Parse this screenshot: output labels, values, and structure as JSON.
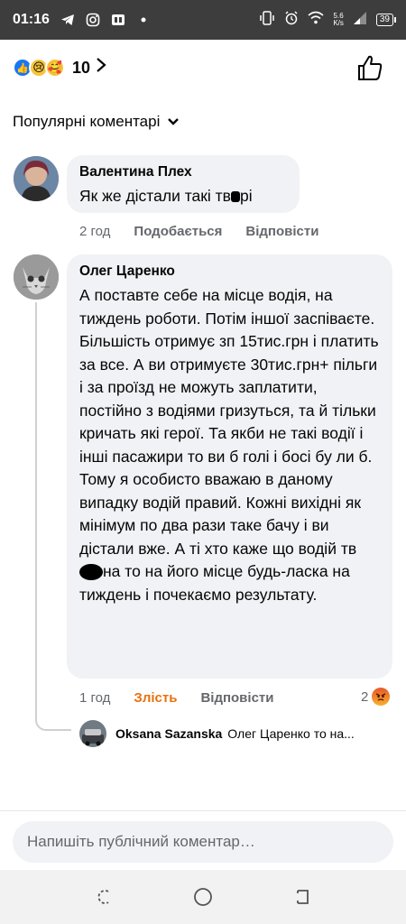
{
  "status_bar": {
    "time": "01:16",
    "icons": [
      "telegram-icon",
      "instagram-icon",
      "app-icon",
      "dot-icon",
      "vibrate-icon",
      "alarm-icon",
      "wifi-icon",
      "signal-icon"
    ],
    "net_speed_value": "5.6",
    "net_speed_unit": "K/s",
    "battery": "39"
  },
  "reactions": {
    "icons": [
      "like-reaction-icon",
      "sad-reaction-icon",
      "care-reaction-icon"
    ],
    "count": "10"
  },
  "sort": {
    "label": "Популярні коментарі"
  },
  "comments": [
    {
      "author": "Валентина Плех",
      "text": "Як же дістали такі тв",
      "text_after": "рі",
      "time": "2 год",
      "like_label": "Подобається",
      "reply_label": "Відповісти"
    },
    {
      "author": "Олег Царенко",
      "text": "А поставте себе на місце водія, на тиждень роботи. Потім іншої заспіваєте. Більшість отримує зп 15тис.грн і платить за все. А ви отримуєте 30тис.грн+ пільги і за проїзд не можуть заплатити, постійно з водіями гризуться, та й тільки кричать які герої. Та якби не такі водії і інші пасажири то ви б голі і босі бу ли б. Тому я особисто вважаю в даному випадку водій правий. Кожні вихідні як мінімум по два рази таке бачу і ви дістали вже. А ті хто каже що водій тв",
      "text_after": "на то на його місце будь-ласка на тиждень і почекаємо результату.",
      "time": "1 год",
      "reaction_label": "Злість",
      "reply_label": "Відповісти",
      "reaction_count": "2"
    }
  ],
  "reply_preview": {
    "author": "Oksana Sazanska",
    "text": "Олег Царенко то на..."
  },
  "composer": {
    "placeholder": "Напишіть публічний коментар…"
  },
  "colors": {
    "accent": "#1877f2",
    "angry": "#e9710f",
    "bubble": "#f0f2f5",
    "secondary_text": "#65676b"
  }
}
